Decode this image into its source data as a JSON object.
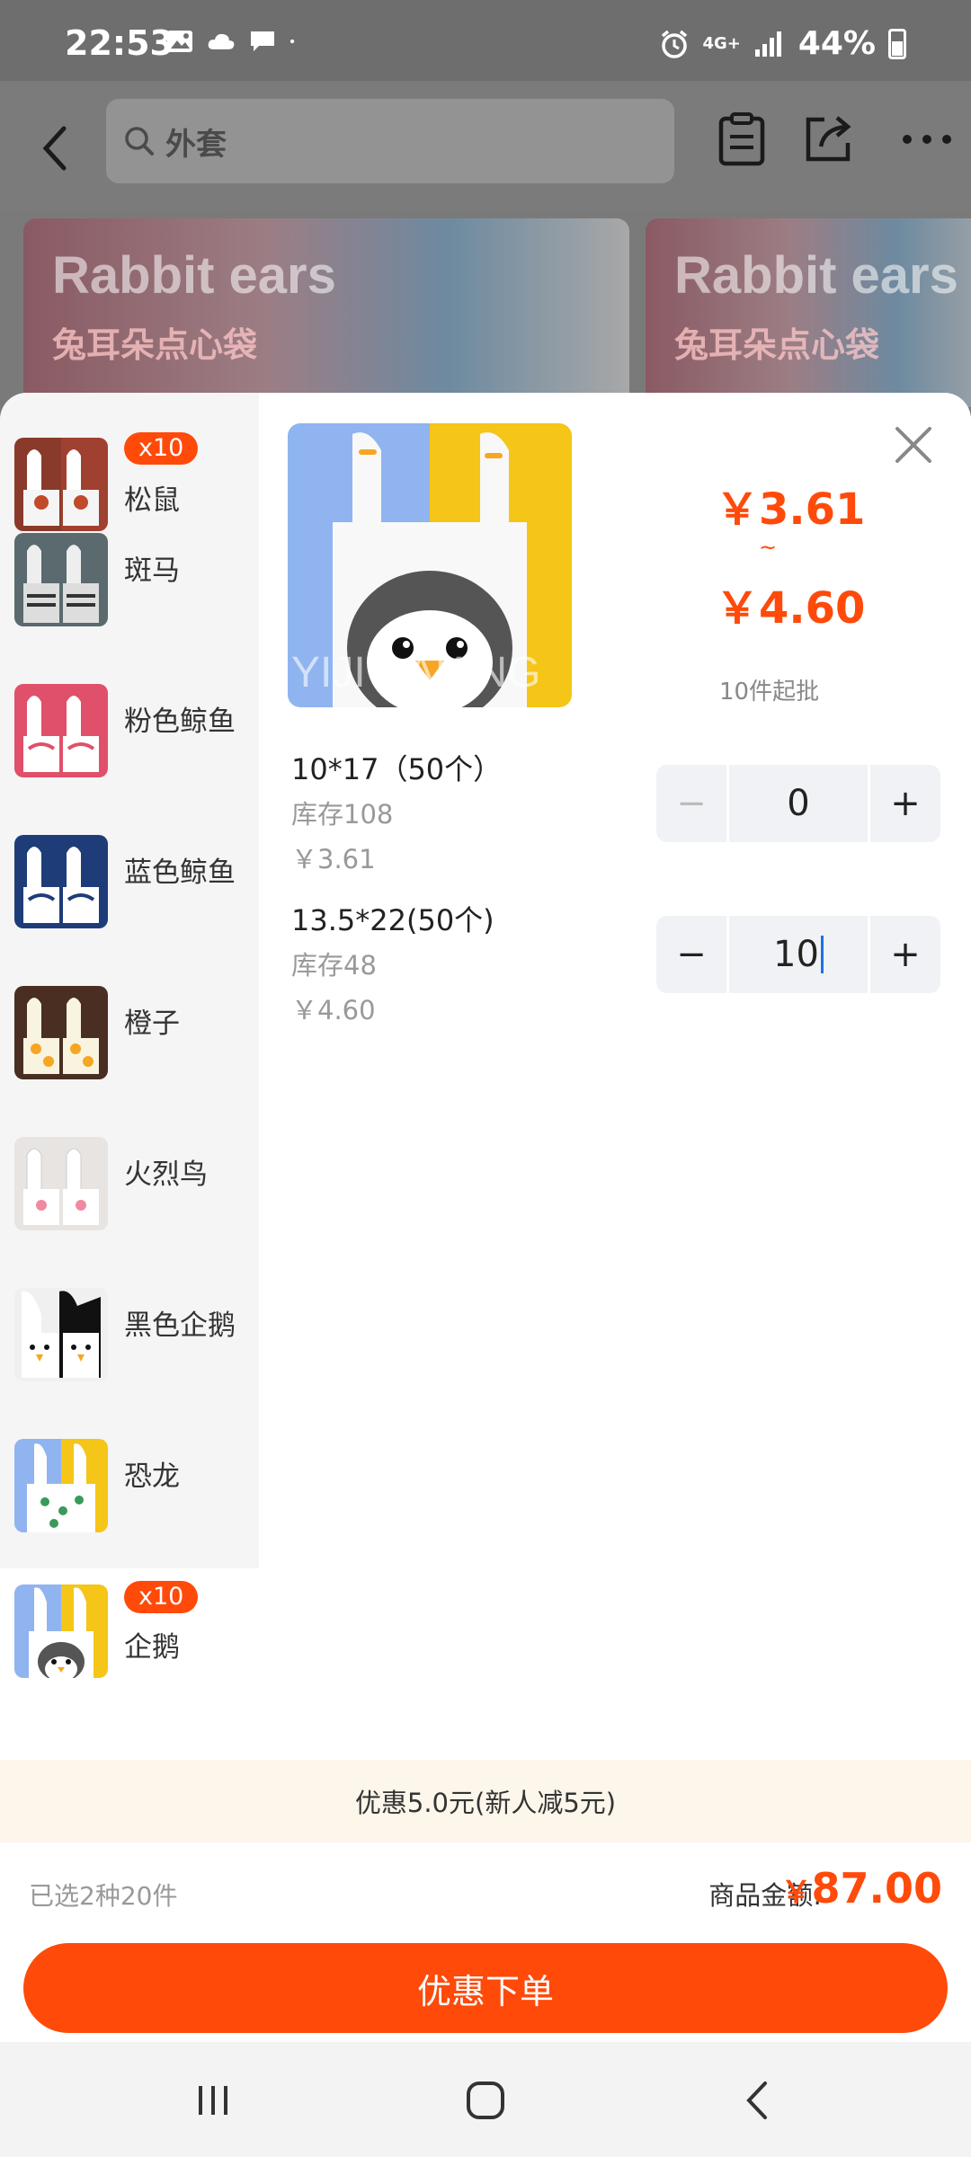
{
  "status_bar": {
    "time": "22:53",
    "network": "4G+",
    "battery": "44%"
  },
  "header": {
    "search_text": "外套"
  },
  "banners": [
    {
      "title": "Rabbit ears",
      "subtitle": "兔耳朵点心袋"
    },
    {
      "title": "Rabbit ears",
      "subtitle": "兔耳朵点心袋"
    }
  ],
  "sidebar": {
    "items": [
      {
        "name": "松鼠",
        "badge": "x10"
      },
      {
        "name": "斑马"
      },
      {
        "name": "粉色鲸鱼"
      },
      {
        "name": "蓝色鲸鱼"
      },
      {
        "name": "橙子"
      },
      {
        "name": "火烈鸟"
      },
      {
        "name": "黑色企鹅"
      },
      {
        "name": "恐龙"
      },
      {
        "name": "企鹅",
        "badge": "x10"
      }
    ]
  },
  "product": {
    "price_low": "￥3.61",
    "tilde": "~",
    "price_high": "￥4.60",
    "min_order": "10件起批",
    "image_watermark": "YIJI BAKING"
  },
  "variants": [
    {
      "name": "10*17（50个）",
      "stock": "库存108",
      "price": "￥3.61",
      "qty": "0",
      "minus": "−",
      "plus": "+"
    },
    {
      "name": "13.5*22(50个)",
      "stock": "库存48",
      "price": "￥4.60",
      "qty": "10",
      "minus": "−",
      "plus": "+"
    }
  ],
  "promo": {
    "text": "优惠5.0元(新人减5元)"
  },
  "summary": {
    "selected": "已选2种20件",
    "total_label": "商品金额:",
    "currency": "￥",
    "total_value": "87.00",
    "order_button": "优惠下单"
  },
  "colors": {
    "accent": "#ff4a0a",
    "promo_bg": "#fdf6ea"
  }
}
